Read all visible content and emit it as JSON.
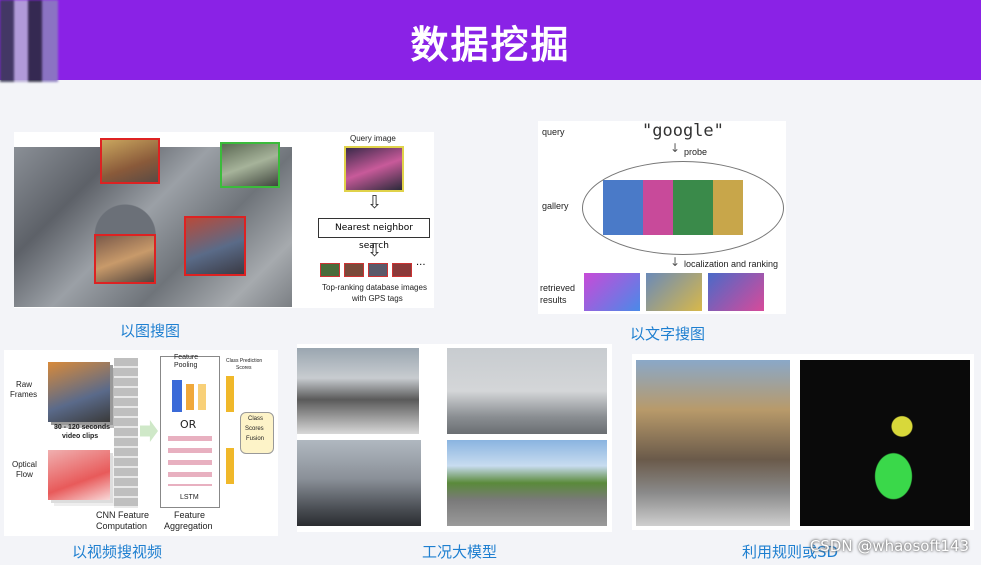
{
  "header": {
    "title": "数据挖掘"
  },
  "panel1": {
    "query_label": "Query image",
    "search_box": "Nearest neighbor search",
    "result_caption_line1": "Top-ranking database images",
    "result_caption_line2": "with GPS tags",
    "caption": "以图搜图"
  },
  "panel2": {
    "query_label": "query",
    "query_text": "\"google\"",
    "probe_label": "probe",
    "gallery_label": "gallery",
    "localization_label": "localization and ranking",
    "retrieved_line1": "retrieved",
    "retrieved_line2": "results",
    "caption": "以文字搜图"
  },
  "panel3": {
    "raw_frames_line1": "Raw",
    "raw_frames_line2": "Frames",
    "clips_line1": "30 - 120 seconds",
    "clips_line2": "video clips",
    "optical_line1": "Optical",
    "optical_line2": "Flow",
    "feature_pooling_line1": "Feature",
    "feature_pooling_line2": "Pooling",
    "or_label": "OR",
    "lstm_label": "LSTM",
    "class_prediction_line1": "Class Prediction",
    "class_prediction_line2": "Scores",
    "class_fusion_line1": "Class",
    "class_fusion_line2": "Scores",
    "class_fusion_line3": "Fusion",
    "cnn_line1": "CNN Feature",
    "cnn_line2": "Computation",
    "agg_line1": "Feature",
    "agg_line2": "Aggregation",
    "caption": "以视频搜视频"
  },
  "panel4": {
    "caption": "工况大模型"
  },
  "panel5": {
    "caption": "利用规则或SD"
  },
  "watermark": "CSDN @whaosoft143",
  "colors": {
    "header": "#8a22e6",
    "caption": "#1e7fd0"
  }
}
